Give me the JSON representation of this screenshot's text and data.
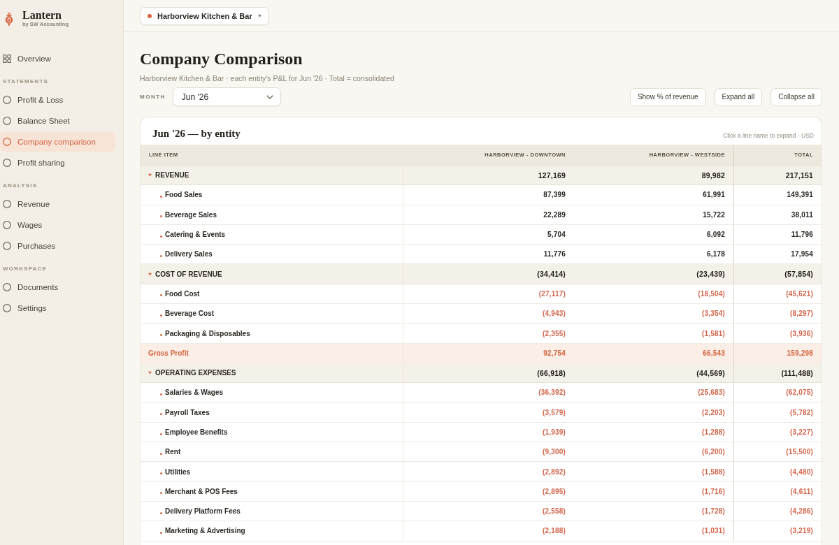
{
  "sidebar": {
    "brand": {
      "name": "Lantern",
      "tagline": "by SW Accounting"
    },
    "top_items": [
      {
        "label": "Overview",
        "selected": false
      }
    ],
    "sections": [
      {
        "title": "STATEMENTS",
        "items": [
          {
            "label": "Profit & Loss",
            "selected": false
          },
          {
            "label": "Balance Sheet",
            "selected": false
          },
          {
            "label": "Company comparison",
            "selected": true
          },
          {
            "label": "Profit sharing",
            "selected": false
          }
        ]
      },
      {
        "title": "ANALYSIS",
        "items": [
          {
            "label": "Revenue",
            "selected": false
          },
          {
            "label": "Wages",
            "selected": false
          },
          {
            "label": "Purchases",
            "selected": false
          }
        ]
      },
      {
        "title": "WORKSPACE",
        "items": [
          {
            "label": "Documents",
            "selected": false
          },
          {
            "label": "Settings",
            "selected": false
          }
        ]
      }
    ]
  },
  "top_bar": {
    "company_selector": {
      "label": "Harborview Kitchen & Bar"
    }
  },
  "page": {
    "title": "Company Comparison",
    "subtitle": "Harborview Kitchen & Bar · each entity's P&L for Jun '26 · Total = consolidated",
    "month": {
      "label": "MONTH",
      "value": "Jun '26"
    },
    "buttons": [
      "Show % of revenue",
      "Expand all",
      "Collapse all"
    ]
  },
  "table": {
    "title": "Jun '26 — by entity",
    "hint": "Click a line name to expand · USD",
    "columns": [
      "LINE ITEM",
      "HARBORVIEW - DOWNTOWN",
      "HARBORVIEW - WESTSIDE",
      "TOTAL"
    ],
    "rows": [
      {
        "kind": "group",
        "label": "REVENUE",
        "expanded": true,
        "values": [
          "127,169",
          "89,982",
          "217,151"
        ],
        "children": [
          {
            "kind": "line",
            "label": "Food Sales",
            "negative": false,
            "values": [
              "87,399",
              "61,991",
              "149,391"
            ]
          },
          {
            "kind": "line",
            "label": "Beverage Sales",
            "negative": false,
            "values": [
              "22,289",
              "15,722",
              "38,011"
            ]
          },
          {
            "kind": "line",
            "label": "Catering & Events",
            "negative": false,
            "values": [
              "5,704",
              "6,092",
              "11,796"
            ]
          },
          {
            "kind": "line",
            "label": "Delivery Sales",
            "negative": false,
            "values": [
              "11,776",
              "6,178",
              "17,954"
            ]
          }
        ]
      },
      {
        "kind": "group",
        "label": "COST OF REVENUE",
        "expanded": true,
        "values": [
          "(34,414)",
          "(23,439)",
          "(57,854)"
        ],
        "children": [
          {
            "kind": "line",
            "label": "Food Cost",
            "negative": true,
            "values": [
              "(27,117)",
              "(18,504)",
              "(45,621)"
            ]
          },
          {
            "kind": "line",
            "label": "Beverage Cost",
            "negative": true,
            "values": [
              "(4,943)",
              "(3,354)",
              "(8,297)"
            ]
          },
          {
            "kind": "line",
            "label": "Packaging & Disposables",
            "negative": true,
            "values": [
              "(2,355)",
              "(1,581)",
              "(3,936)"
            ]
          }
        ]
      },
      {
        "kind": "subtotal",
        "label": "Gross Profit",
        "values": [
          "92,754",
          "66,543",
          "159,298"
        ]
      },
      {
        "kind": "group",
        "label": "OPERATING EXPENSES",
        "expanded": true,
        "values": [
          "(66,918)",
          "(44,569)",
          "(111,488)"
        ],
        "children": [
          {
            "kind": "line",
            "label": "Salaries & Wages",
            "negative": true,
            "values": [
              "(36,392)",
              "(25,683)",
              "(62,075)"
            ]
          },
          {
            "kind": "line",
            "label": "Payroll Taxes",
            "negative": true,
            "values": [
              "(3,579)",
              "(2,203)",
              "(5,782)"
            ]
          },
          {
            "kind": "line",
            "label": "Employee Benefits",
            "negative": true,
            "values": [
              "(1,939)",
              "(1,288)",
              "(3,227)"
            ]
          },
          {
            "kind": "line",
            "label": "Rent",
            "negative": true,
            "values": [
              "(9,300)",
              "(6,200)",
              "(15,500)"
            ]
          },
          {
            "kind": "line",
            "label": "Utilities",
            "negative": true,
            "values": [
              "(2,892)",
              "(1,588)",
              "(4,480)"
            ]
          },
          {
            "kind": "line",
            "label": "Merchant & POS Fees",
            "negative": true,
            "values": [
              "(2,895)",
              "(1,716)",
              "(4,611)"
            ]
          },
          {
            "kind": "line",
            "label": "Delivery Platform Fees",
            "negative": true,
            "values": [
              "(2,558)",
              "(1,728)",
              "(4,286)"
            ]
          },
          {
            "kind": "line",
            "label": "Marketing & Advertising",
            "negative": true,
            "values": [
              "(2,188)",
              "(1,031)",
              "(3,219)"
            ]
          }
        ]
      }
    ]
  }
}
